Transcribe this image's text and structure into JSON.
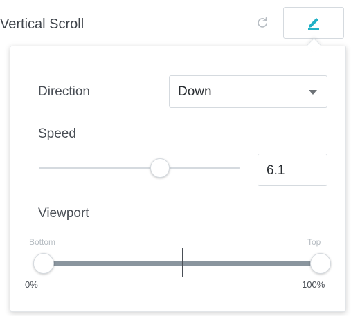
{
  "header": {
    "title": "Vertical Scroll",
    "reset_icon": "reset-icon",
    "edit_icon": "pencil-icon",
    "accent_color": "#39b54a"
  },
  "direction": {
    "label": "Direction",
    "value": "Down"
  },
  "speed": {
    "label": "Speed",
    "value": "6.1",
    "slider_fraction": 0.61
  },
  "viewport": {
    "label": "Viewport",
    "start_label": "Bottom",
    "end_label": "Top",
    "min_label": "0%",
    "max_label": "100%",
    "start_value": 0,
    "end_value": 100
  }
}
